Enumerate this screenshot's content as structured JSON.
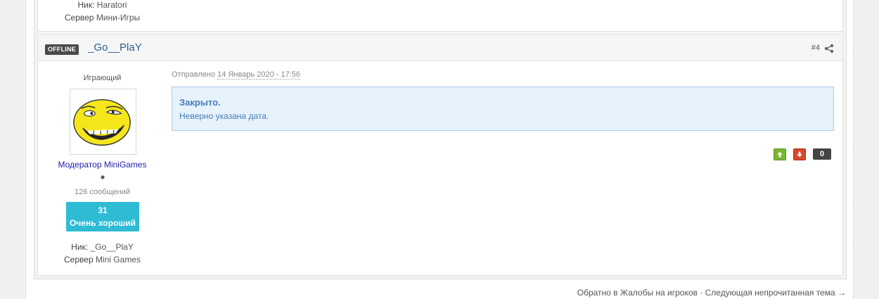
{
  "previous_post": {
    "nick_label": "Ник:",
    "nick_value": "Haratori",
    "server_label": "Сервер",
    "server_value": "Мини-Игры"
  },
  "post": {
    "status_badge": "OFFLINE",
    "author_name": "_Go__PlaY",
    "post_number": "#4",
    "share_icon": "share-icon",
    "author": {
      "group": "Играющий",
      "title": "Модератор MiniGames",
      "post_count": "126 сообщений",
      "reputation_value": "31",
      "reputation_label": "Очень хороший",
      "nick_label": "Ник:",
      "nick_value": "_Go__PlaY",
      "server_label": "Сервер",
      "server_value": "Mini Games"
    },
    "posted_label": "Отправлено",
    "posted_date": "14 Январь 2020 - 17:56",
    "notice_title": "Закрыто.",
    "notice_text": "Неверно указана дата.",
    "vote_up_icon": "arrow-up-icon",
    "vote_down_icon": "arrow-down-icon",
    "reputation_count": "0"
  },
  "footer": {
    "back_link": "Обратно в Жалобы на игроков",
    "separator": "·",
    "next_link": "Следующая непрочитанная тема →"
  },
  "colors": {
    "author_name": "#2b5f8f",
    "user_title": "#1e1ea8",
    "reputation_box": "#2ebbd4",
    "notice_bg": "#e6f2fc",
    "vote_up": "#7ab632",
    "vote_down": "#d8482a"
  }
}
